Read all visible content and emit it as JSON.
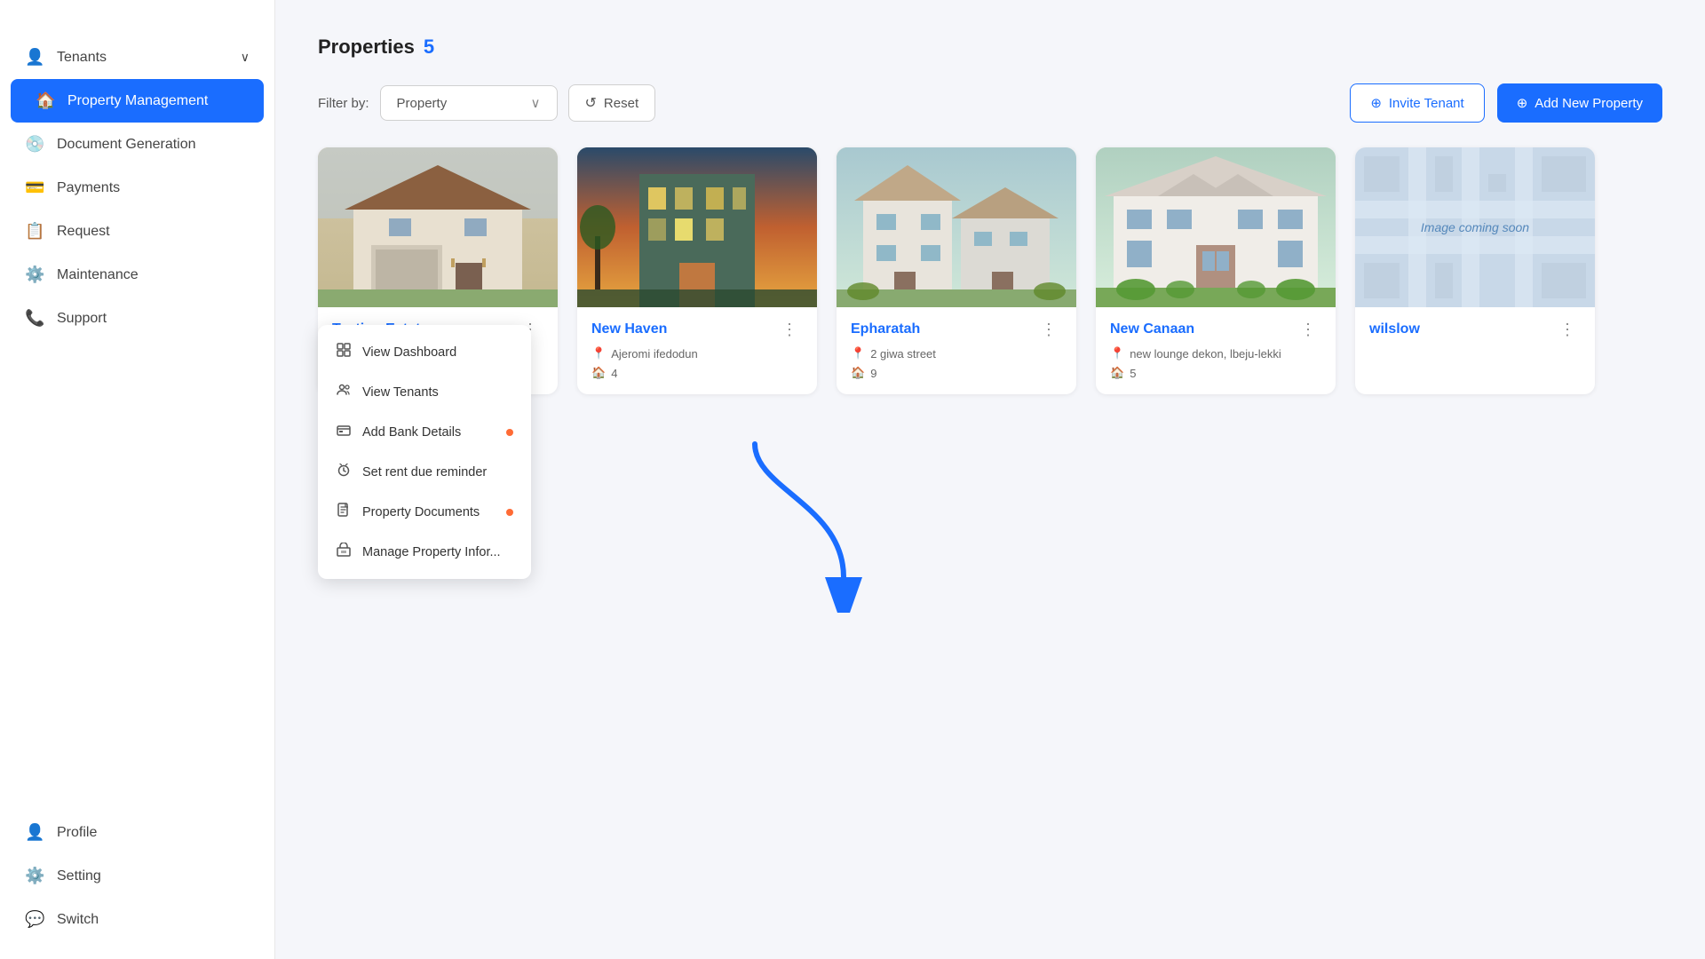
{
  "sidebar": {
    "items": [
      {
        "id": "tenants",
        "label": "Tenants",
        "icon": "👤",
        "hasChevron": true,
        "active": false
      },
      {
        "id": "property-management",
        "label": "Property Management",
        "icon": "🏠",
        "active": true
      },
      {
        "id": "document-generation",
        "label": "Document Generation",
        "icon": "💿",
        "active": false
      },
      {
        "id": "payments",
        "label": "Payments",
        "icon": "💳",
        "active": false
      },
      {
        "id": "request",
        "label": "Request",
        "icon": "📋",
        "active": false
      },
      {
        "id": "maintenance",
        "label": "Maintenance",
        "icon": "⚙️",
        "active": false
      },
      {
        "id": "support",
        "label": "Support",
        "icon": "📞",
        "active": false
      },
      {
        "id": "profile",
        "label": "Profile",
        "icon": "👤",
        "active": false
      },
      {
        "id": "setting",
        "label": "Setting",
        "icon": "⚙️",
        "active": false
      },
      {
        "id": "switch",
        "label": "Switch",
        "icon": "💬",
        "active": false
      }
    ]
  },
  "page": {
    "title": "Properties",
    "count": "5",
    "filter_label": "Filter by:",
    "filter_placeholder": "Property",
    "reset_label": "Reset",
    "invite_label": "Invite Tenant",
    "add_label": "Add New Property"
  },
  "properties": [
    {
      "id": "testing-estate",
      "name": "Testing Estate",
      "location": "",
      "units": "",
      "has_image": true,
      "image_class": "house-img-1",
      "menu_open": true
    },
    {
      "id": "new-haven",
      "name": "New Haven",
      "location": "Ajeromi ifedodun",
      "units": "4",
      "has_image": true,
      "image_class": "house-img-2",
      "menu_open": false
    },
    {
      "id": "epharatah",
      "name": "Epharatah",
      "location": "2 giwa street",
      "units": "9",
      "has_image": true,
      "image_class": "house-img-3",
      "menu_open": false
    },
    {
      "id": "new-canaan",
      "name": "New Canaan",
      "location": "new lounge dekon, lbeju-lekki",
      "units": "5",
      "has_image": true,
      "image_class": "house-img-4",
      "menu_open": false
    },
    {
      "id": "wilslow",
      "name": "wilslow",
      "location": "",
      "units": "",
      "has_image": false,
      "image_class": "",
      "menu_open": false,
      "image_coming_soon": true
    }
  ],
  "dropdown": {
    "items": [
      {
        "id": "view-dashboard",
        "label": "View Dashboard",
        "icon": "▦",
        "has_warning": false
      },
      {
        "id": "view-tenants",
        "label": "View Tenants",
        "icon": "♣",
        "has_warning": false
      },
      {
        "id": "add-bank-details",
        "label": "Add Bank Details",
        "icon": "🗃",
        "has_warning": true
      },
      {
        "id": "set-rent-reminder",
        "label": "Set rent due reminder",
        "icon": "🕐",
        "has_warning": false
      },
      {
        "id": "property-documents",
        "label": "Property Documents",
        "icon": "📄",
        "has_warning": true
      },
      {
        "id": "manage-property-info",
        "label": "Manage Property Infor...",
        "icon": "🏢",
        "has_warning": false
      }
    ]
  }
}
